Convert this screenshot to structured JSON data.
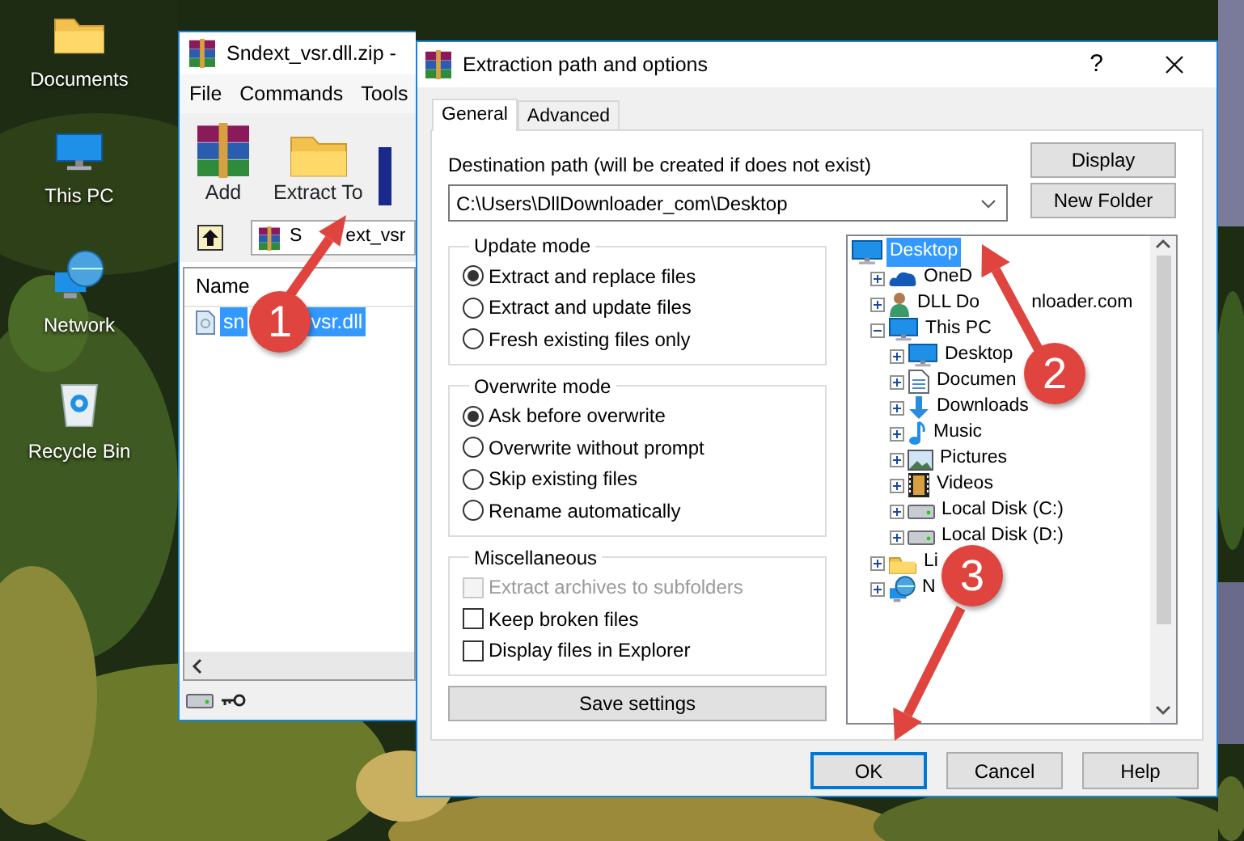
{
  "desktop": {
    "icons": [
      {
        "label": "Documents"
      },
      {
        "label": "This PC"
      },
      {
        "label": "Network"
      },
      {
        "label": "Recycle Bin"
      }
    ]
  },
  "archive_window": {
    "title": "Sndext_vsr.dll.zip -",
    "menu": [
      "File",
      "Commands",
      "Tools"
    ],
    "toolbar": [
      {
        "label": "Add"
      },
      {
        "label": "Extract To"
      }
    ],
    "path_parts": [
      "S",
      "ext_vsr"
    ],
    "columns": [
      "Name"
    ],
    "files": [
      {
        "name_parts": [
          "sn",
          "vsr.dll"
        ],
        "selected": true
      }
    ]
  },
  "dialog": {
    "title": "Extraction path and options",
    "help": "?",
    "tabs": [
      {
        "label": "General",
        "selected": true
      },
      {
        "label": "Advanced",
        "selected": false
      }
    ],
    "destination": {
      "label": "Destination path (will be created if does not exist)",
      "value": "C:\\Users\\DllDownloader_com\\Desktop"
    },
    "side_buttons": [
      "Display",
      "New Folder"
    ],
    "groups": [
      {
        "title": "Update mode",
        "options": [
          {
            "kind": "radio",
            "label": "Extract and replace files",
            "checked": true,
            "disabled": false
          },
          {
            "kind": "radio",
            "label": "Extract and update files",
            "checked": false,
            "disabled": false
          },
          {
            "kind": "radio",
            "label": "Fresh existing files only",
            "checked": false,
            "disabled": false
          }
        ]
      },
      {
        "title": "Overwrite mode",
        "options": [
          {
            "kind": "radio",
            "label": "Ask before overwrite",
            "checked": true,
            "disabled": false
          },
          {
            "kind": "radio",
            "label": "Overwrite without prompt",
            "checked": false,
            "disabled": false
          },
          {
            "kind": "radio",
            "label": "Skip existing files",
            "checked": false,
            "disabled": false
          },
          {
            "kind": "radio",
            "label": "Rename automatically",
            "checked": false,
            "disabled": false
          }
        ]
      },
      {
        "title": "Miscellaneous",
        "options": [
          {
            "kind": "checkbox",
            "label": "Extract archives to subfolders",
            "checked": false,
            "disabled": true
          },
          {
            "kind": "checkbox",
            "label": "Keep broken files",
            "checked": false,
            "disabled": false
          },
          {
            "kind": "checkbox",
            "label": "Display files in Explorer",
            "checked": false,
            "disabled": false
          }
        ]
      }
    ],
    "save_button": "Save settings",
    "tree": [
      {
        "label": "Desktop",
        "selected": true,
        "children": [
          {
            "label": "OneD",
            "selected": false,
            "expanded": false
          },
          {
            "label": "DLL Do",
            "label_tail": "nloader.com",
            "selected": false,
            "expanded": false
          },
          {
            "label": "This PC",
            "selected": false,
            "expanded": true,
            "children": [
              {
                "label": "Desktop",
                "selected": false,
                "expanded": false
              },
              {
                "label": "Documen",
                "selected": false,
                "expanded": false
              },
              {
                "label": "Downloads",
                "selected": false,
                "expanded": false
              },
              {
                "label": "Music",
                "selected": false,
                "expanded": false
              },
              {
                "label": "Pictures",
                "selected": false,
                "expanded": false
              },
              {
                "label": "Videos",
                "selected": false,
                "expanded": false
              },
              {
                "label": "Local Disk (C:)",
                "selected": false,
                "expanded": false
              },
              {
                "label": "Local Disk (D:)",
                "selected": false,
                "expanded": false
              }
            ]
          },
          {
            "label": "Li",
            "selected": false,
            "expanded": false
          },
          {
            "label": "N",
            "selected": false,
            "expanded": false
          }
        ]
      }
    ],
    "buttons": [
      {
        "label": "OK",
        "default": true
      },
      {
        "label": "Cancel",
        "default": false
      },
      {
        "label": "Help",
        "default": false
      }
    ]
  },
  "annotations": [
    {
      "number": "1"
    },
    {
      "number": "2"
    },
    {
      "number": "3"
    }
  ]
}
